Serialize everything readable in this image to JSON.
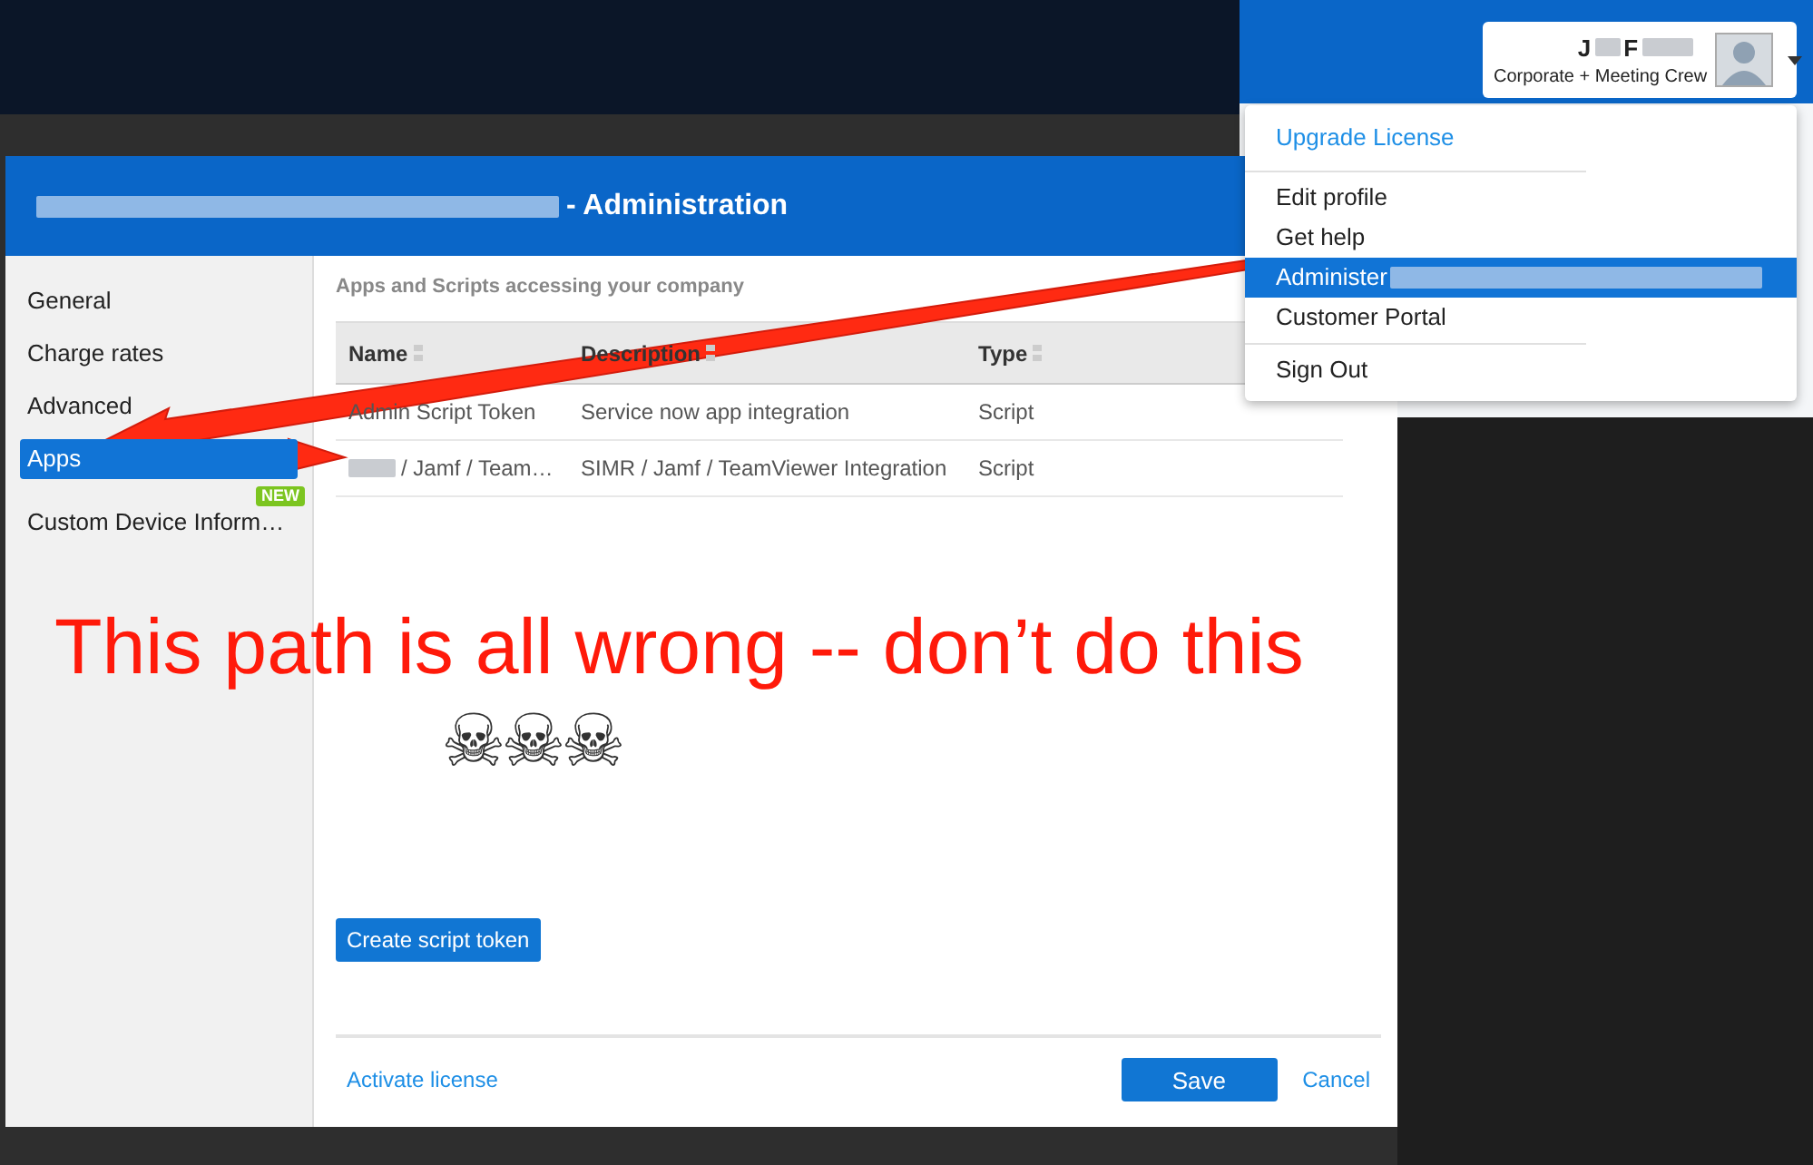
{
  "user_card": {
    "name_parts": [
      "J",
      "F"
    ],
    "subtitle": "Corporate + Meeting Crew"
  },
  "dropdown_menu": [
    {
      "label": "Upgrade License",
      "kind": "link",
      "selected": false,
      "divider_after": true
    },
    {
      "label": "Edit profile",
      "kind": "item",
      "selected": false,
      "divider_after": false
    },
    {
      "label": "Get help",
      "kind": "item",
      "selected": false,
      "divider_after": false
    },
    {
      "label": "Administer",
      "kind": "item",
      "selected": true,
      "redacted_suffix": true,
      "divider_after": false
    },
    {
      "label": "Customer Portal",
      "kind": "item",
      "selected": false,
      "divider_after": true
    },
    {
      "label": "Sign Out",
      "kind": "item",
      "selected": false,
      "divider_after": false
    }
  ],
  "window": {
    "title": "- Administration"
  },
  "sidebar": {
    "items": [
      {
        "label": "General",
        "selected": false
      },
      {
        "label": "Charge rates",
        "selected": false
      },
      {
        "label": "Advanced",
        "selected": false
      },
      {
        "label": "Apps",
        "selected": true
      },
      {
        "label": "Custom Device Inform…",
        "selected": false,
        "badge": "NEW"
      }
    ]
  },
  "section_title": "Apps and Scripts accessing your company",
  "table": {
    "columns": [
      "Name",
      "Description",
      "Type"
    ],
    "rows": [
      {
        "name": "Admin Script Token",
        "redacted_prefix": false,
        "description": "Service now app integration",
        "type": "Script"
      },
      {
        "name": "/ Jamf / Team…",
        "redacted_prefix": true,
        "description": "SIMR / Jamf / TeamViewer Integration",
        "type": "Script"
      }
    ]
  },
  "create_button": "Create script token",
  "footer": {
    "link": "Activate license",
    "save": "Save",
    "cancel": "Cancel"
  },
  "annotation": {
    "text": "This path is all wrong -- don’t do this",
    "symbols": "☠☠☠"
  }
}
